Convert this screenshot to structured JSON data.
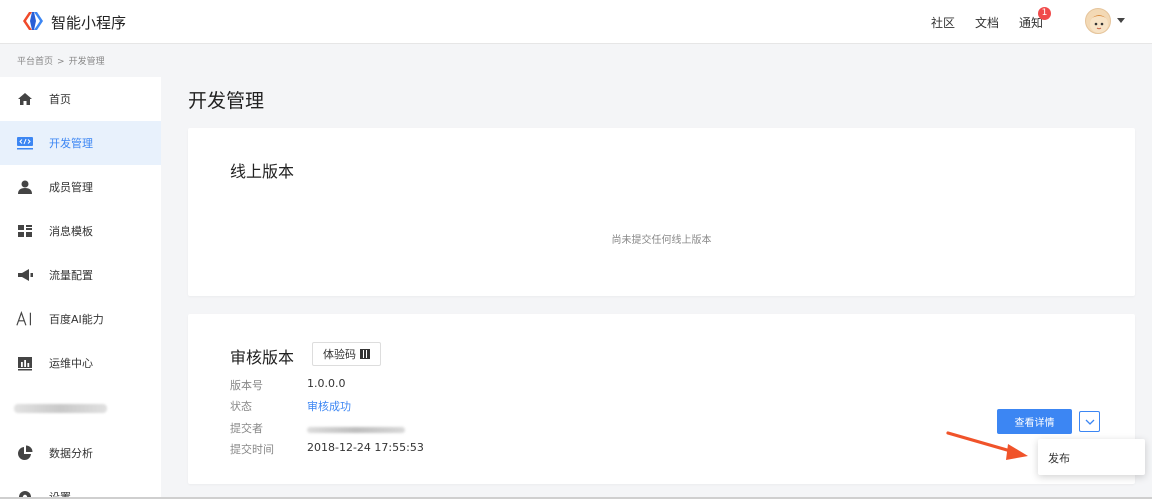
{
  "header": {
    "brand": "智能小程序",
    "nav": [
      "社区",
      "文档",
      "通知"
    ],
    "notification_count": "1"
  },
  "breadcrumb": {
    "items": [
      "平台首页",
      "开发管理"
    ],
    "separator": ">"
  },
  "sidebar": {
    "items": [
      {
        "label": "首页",
        "icon": "home-icon"
      },
      {
        "label": "开发管理",
        "icon": "code-icon",
        "active": true
      },
      {
        "label": "成员管理",
        "icon": "user-icon"
      },
      {
        "label": "消息模板",
        "icon": "template-icon"
      },
      {
        "label": "流量配置",
        "icon": "megaphone-icon"
      },
      {
        "label": "百度AI能力",
        "icon": "ai-icon"
      },
      {
        "label": "运维中心",
        "icon": "chart-icon"
      },
      {
        "label": "数据分析",
        "icon": "pie-icon"
      },
      {
        "label": "设置",
        "icon": "gear-icon"
      }
    ]
  },
  "page": {
    "title": "开发管理"
  },
  "online_version": {
    "title": "线上版本",
    "empty_text": "尚未提交任何线上版本"
  },
  "review_version": {
    "title": "审核版本",
    "qr_button": "体验码",
    "fields": [
      {
        "label": "版本号",
        "value": "1.0.0.0"
      },
      {
        "label": "状态",
        "value": "审核成功"
      },
      {
        "label": "提交者",
        "value": ""
      },
      {
        "label": "提交时间",
        "value": "2018-12-24 17:55:53"
      }
    ],
    "detail_button": "查看详情",
    "menu_items": [
      "发布"
    ]
  },
  "colors": {
    "accent": "#3c86f3",
    "badge": "#f04a4a",
    "arrow": "#f0532a"
  }
}
